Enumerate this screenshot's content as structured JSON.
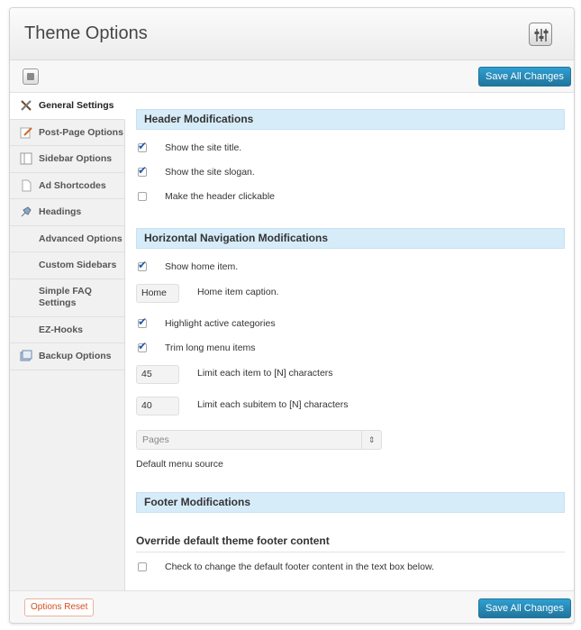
{
  "header": {
    "title": "Theme Options",
    "icon": "settings-sliders-icon"
  },
  "toolbar": {
    "save_label": "Save All Changes",
    "icon": "panel-toggle-icon"
  },
  "sidebar": {
    "items": [
      {
        "label": "General Settings",
        "icon": "wrench-screwdriver-icon",
        "active": true
      },
      {
        "label": "Post-Page Options",
        "icon": "pencil-icon"
      },
      {
        "label": "Sidebar Options",
        "icon": "sidebar-layout-icon"
      },
      {
        "label": "Ad Shortcodes",
        "icon": "page-icon"
      },
      {
        "label": "Headings",
        "icon": "pushpin-icon"
      },
      {
        "label": "Advanced Options",
        "icon": ""
      },
      {
        "label": "Custom Sidebars",
        "icon": ""
      },
      {
        "label": "Simple FAQ Settings",
        "icon": ""
      },
      {
        "label": "EZ-Hooks",
        "icon": ""
      },
      {
        "label": "Backup Options",
        "icon": "backup-icon"
      }
    ]
  },
  "sections": {
    "header_mods": {
      "title": "Header Modifications",
      "options": [
        {
          "label": "Show the site title.",
          "checked": true
        },
        {
          "label": "Show the site slogan.",
          "checked": true
        },
        {
          "label": "Make the header clickable",
          "checked": false
        }
      ]
    },
    "nav_mods": {
      "title": "Horizontal Navigation Modifications",
      "show_home": {
        "label": "Show home item.",
        "checked": true
      },
      "home_caption": {
        "value": "Home",
        "label": "Home item caption."
      },
      "highlight": {
        "label": "Highlight active categories",
        "checked": true
      },
      "trim": {
        "label": "Trim long menu items",
        "checked": true
      },
      "limit_item": {
        "value": "45",
        "label": "Limit each item to [N] characters"
      },
      "limit_subitem": {
        "value": "40",
        "label": "Limit each subitem to [N] characters"
      },
      "menu_source": {
        "value": "Pages",
        "label": "Default menu source"
      }
    },
    "footer_mods": {
      "title": "Footer Modifications",
      "subheading": "Override default theme footer content",
      "override": {
        "label": "Check to change the default footer content in the text box below.",
        "checked": false
      }
    }
  },
  "footer": {
    "reset_label": "Options Reset",
    "save_label": "Save All Changes"
  },
  "colors": {
    "accent": "#21759b",
    "section_bg": "#d7ecf9",
    "reset": "#d54e21"
  }
}
